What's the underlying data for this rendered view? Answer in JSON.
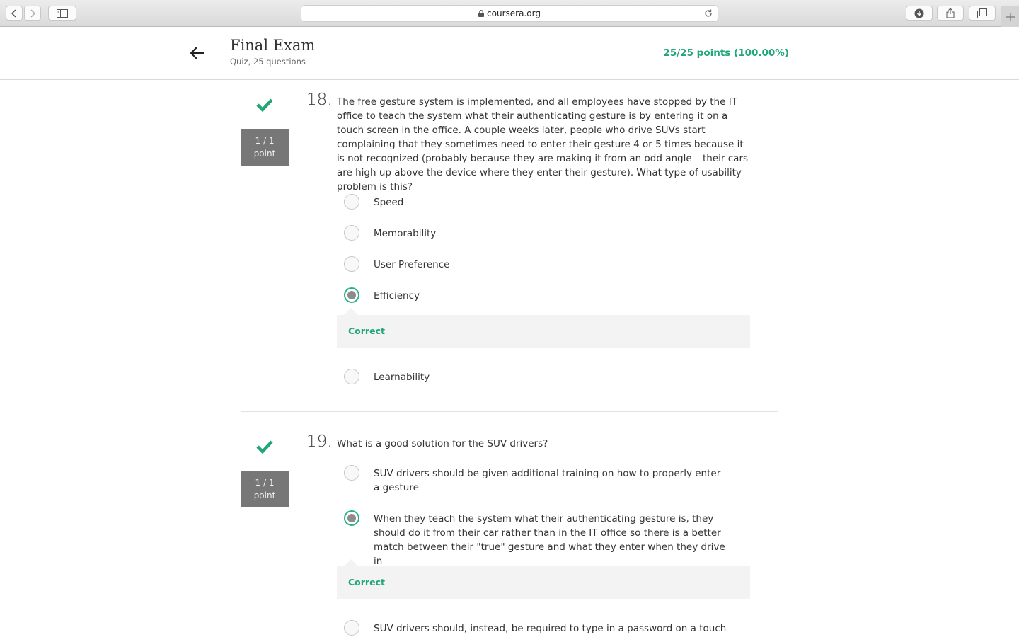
{
  "browser": {
    "url": "coursera.org"
  },
  "quiz": {
    "title": "Final Exam",
    "subtitle": "Quiz, 25 questions",
    "score": "25/25 points (100.00%)"
  },
  "questions": [
    {
      "number": "18.",
      "points_line1": "1 / 1",
      "points_line2": "point",
      "text": "The free gesture system is implemented, and all employees have stopped by the IT office to teach the system what their authenticating gesture is by entering it on a touch screen in the office. A couple weeks later, people who drive SUVs start complaining that they sometimes need to enter their gesture 4 or 5 times because it is not recognized (probably because they are making it from an odd angle – their cars are high up above the device where they enter their gesture). What type of usability problem is this?",
      "options": [
        "Speed",
        "Memorability",
        "User Preference",
        "Efficiency",
        "Learnability"
      ],
      "selected_index": 3,
      "feedback": "Correct"
    },
    {
      "number": "19.",
      "points_line1": "1 / 1",
      "points_line2": "point",
      "text": "What is a good solution for the SUV drivers?",
      "options": [
        "SUV drivers should be given additional training on how to properly enter a gesture",
        "When they teach the system what their authenticating gesture is, they should do it from their car rather than in the IT office so there is a better match between their \"true\" gesture and what they enter when they drive in",
        "SUV drivers should, instead, be required to type in a password on a touch"
      ],
      "selected_index": 1,
      "feedback": "Correct"
    }
  ]
}
